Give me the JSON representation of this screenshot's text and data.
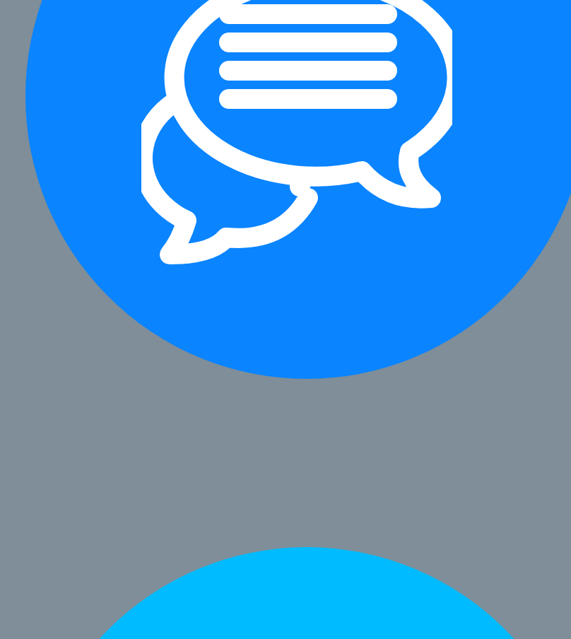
{
  "circles": [
    {
      "kind": "chat",
      "color": "#0a84ff"
    },
    {
      "kind": "plain",
      "color": "#00bbff"
    }
  ]
}
